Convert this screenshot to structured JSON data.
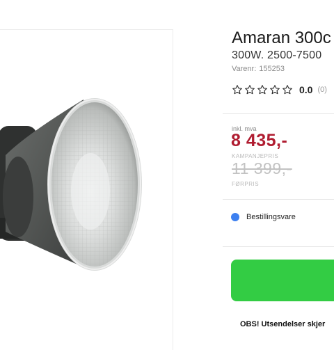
{
  "product": {
    "title": "Amaran 300c",
    "subtitle": "300W. 2500-7500",
    "sku_label": "Varenr:",
    "sku": "155253",
    "image_alt": "Amaran 300c LED light with reflector"
  },
  "rating": {
    "stars_filled": 0,
    "stars_total": 5,
    "value": "0.0",
    "count": "(0)"
  },
  "pricing": {
    "vat_label": "inkl. mva",
    "price": "8 435,-",
    "campaign_label": "KAMPANJEPRIS",
    "old_price": "11 399,-",
    "prev_label": "FØRPRIS"
  },
  "stock": {
    "status": "Bestillingsvare",
    "dot_color": "#3d80f0"
  },
  "cart_button": {
    "color": "#33cc44"
  },
  "notice": "OBS! Utsendelser skjer"
}
